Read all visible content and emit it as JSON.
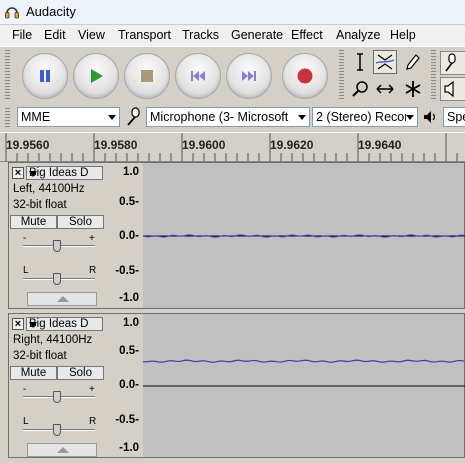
{
  "window": {
    "title": "Audacity"
  },
  "menu": [
    "File",
    "Edit",
    "View",
    "Transport",
    "Tracks",
    "Generate",
    "Effect",
    "Analyze",
    "Help"
  ],
  "transport": [
    {
      "name": "pause-button",
      "icon": "pause-icon",
      "color": "#3a5fcd"
    },
    {
      "name": "play-button",
      "icon": "play-icon",
      "color": "#2e9b2e"
    },
    {
      "name": "stop-button",
      "icon": "stop-icon",
      "color": "#a89b78"
    },
    {
      "name": "skip-start-button",
      "icon": "skip-start-icon",
      "color": "#8a7fd0"
    },
    {
      "name": "skip-end-button",
      "icon": "skip-end-icon",
      "color": "#8a7fd0"
    },
    {
      "name": "record-button",
      "icon": "record-icon",
      "color": "#c8323c"
    }
  ],
  "tools": [
    "selection-tool-icon",
    "envelope-tool-icon",
    "draw-tool-icon",
    "zoom-tool-icon",
    "timeshift-tool-icon",
    "multi-tool-icon"
  ],
  "device": {
    "host": "MME",
    "input": "Microphone (3- Microsoft",
    "channels": "2 (Stereo) Recor",
    "output": "Spe"
  },
  "ruler": {
    "labels": [
      "19.9560",
      "19.9580",
      "19.9600",
      "19.9620",
      "19.9640",
      ""
    ]
  },
  "tracks": [
    {
      "name": "Big Ideas D",
      "channel": "Left, 44100Hz",
      "format": "32-bit float",
      "mute": "Mute",
      "solo": "Solo",
      "gain_minus": "-",
      "gain_plus": "+",
      "pan_left": "L",
      "pan_right": "R",
      "scale": [
        "1.0",
        "0.5-",
        "0.0-",
        "-0.5-",
        "-1.0"
      ],
      "level": 0.0
    },
    {
      "name": "Big Ideas D",
      "channel": "Right, 44100Hz",
      "format": "32-bit float",
      "mute": "Mute",
      "solo": "Solo",
      "gain_minus": "-",
      "gain_plus": "+",
      "pan_left": "L",
      "pan_right": "R",
      "scale": [
        "1.0",
        "0.5-",
        "0.0-",
        "-0.5-",
        "-1.0"
      ],
      "level": 0.4
    }
  ],
  "colors": {
    "waveform": "#3c3cb4",
    "waveform_bg": "#c0c0c0"
  }
}
